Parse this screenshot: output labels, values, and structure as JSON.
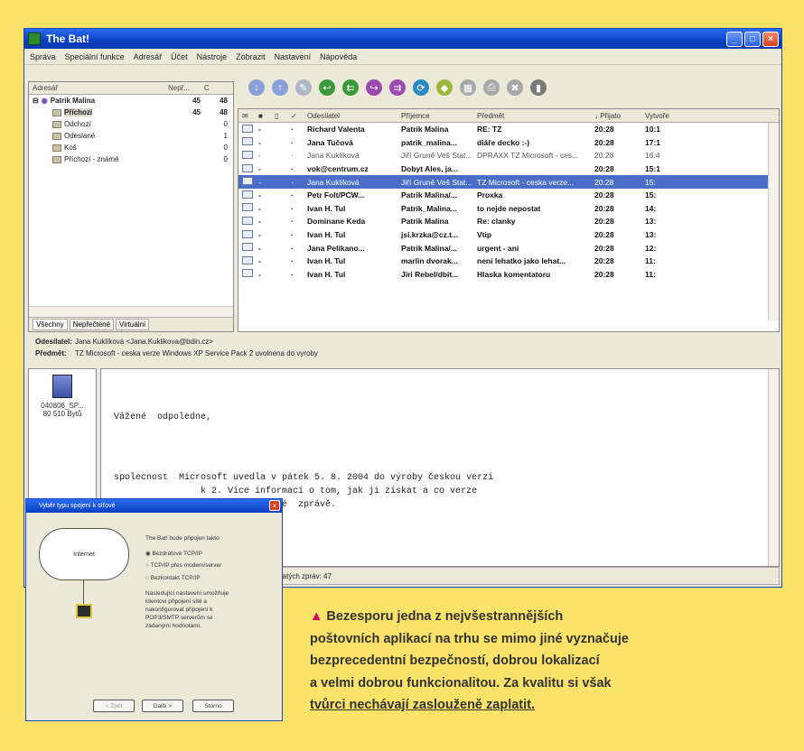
{
  "window": {
    "title": "The Bat!"
  },
  "menu": [
    "Správa",
    "Speciální funkce",
    "Adresář",
    "Účet",
    "Nástroje",
    "Zobrazit",
    "Nastavení",
    "Nápověda"
  ],
  "tree": {
    "headers": [
      "Adresář",
      "Nepř...",
      "C"
    ],
    "rows": [
      {
        "name": "Patrik Malina",
        "unread": "45",
        "total": "48",
        "bold": true
      },
      {
        "name": "Příchozí",
        "unread": "45",
        "total": "48",
        "bold": true
      },
      {
        "name": "Odchozí",
        "unread": "",
        "total": "0",
        "bold": false
      },
      {
        "name": "Odeslané",
        "unread": "",
        "total": "1",
        "bold": false
      },
      {
        "name": "Koš",
        "unread": "",
        "total": "0",
        "bold": false
      },
      {
        "name": "Příchozí - známé",
        "unread": "",
        "total": "0",
        "bold": false
      }
    ],
    "tabs": [
      "Všechny",
      "Nepřečtené",
      "Virtuální"
    ]
  },
  "message_list": {
    "headers": [
      "",
      "",
      "",
      "",
      "Odesílatel",
      "Příjemce",
      "Předmět",
      "↓ Přijato",
      "Vytvoře"
    ],
    "rows": [
      {
        "from": "Richard Valenta",
        "to": "Patrik Malina",
        "subject": "RE: TZ",
        "received": "20:28",
        "created": "10:1",
        "state": "unread"
      },
      {
        "from": "Jana Tučová",
        "to": "patrik_malina...",
        "subject": "diáře decko :-)",
        "received": "20:28",
        "created": "17:1",
        "state": "unread"
      },
      {
        "from": "Jana Kuklíková",
        "to": "Jiří Gruně Veš Stat...",
        "subject": "DPRAXX TZ Microsoft - ces...",
        "received": "20:28",
        "created": "16:4",
        "state": "read"
      },
      {
        "from": "vok@centrum.cz",
        "to": "Dobyt Ales, ja...",
        "subject": "",
        "received": "20:28",
        "created": "15:1",
        "state": "unread"
      },
      {
        "from": "Jana Kuklíková",
        "to": "Jiří Gruně Veš Stat...",
        "subject": "TZ Microsoft - ceska verze...",
        "received": "20:28",
        "created": "15:",
        "state": "selected"
      },
      {
        "from": "Petr Folt/PCW...",
        "to": "Patrik Malina/...",
        "subject": "Proxka",
        "received": "20:28",
        "created": "15:",
        "state": "unread"
      },
      {
        "from": "Ivan H. Tul",
        "to": "Patrik_Malina...",
        "subject": "to nejde nepostat",
        "received": "20:28",
        "created": "14:",
        "state": "unread"
      },
      {
        "from": "Dominane Keda",
        "to": "Patrik Malina",
        "subject": "Re: clanky",
        "received": "20:28",
        "created": "13:",
        "state": "unread"
      },
      {
        "from": "Ivan H. Tul",
        "to": "jsi.krzka@cz.t...",
        "subject": "Vtip",
        "received": "20:28",
        "created": "13:",
        "state": "unread"
      },
      {
        "from": "Jana Pelikano...",
        "to": "Patrik Malina/...",
        "subject": "urgent - ani",
        "received": "20:28",
        "created": "12:",
        "state": "unread"
      },
      {
        "from": "Ivan H. Tul",
        "to": "marlin dvorak...",
        "subject": "neni lehatko jako lehat...",
        "received": "20:28",
        "created": "11:",
        "state": "unread"
      },
      {
        "from": "Ivan H. Tul",
        "to": "Jiri Rebel/dbit...",
        "subject": "Hlaska komentatoru",
        "received": "20:28",
        "created": "11:",
        "state": "unread"
      }
    ]
  },
  "preview": {
    "from_label": "Odesílatel:",
    "from_value": "Jana Kuklíková <Jana.Kuklikova@bdin.cz>",
    "subject_label": "Předmět:",
    "subject_value": "TZ Microsoft - ceska verze Windows XP Service Pack 2 uvolnena do vyroby",
    "attachment_name": "040806_SP...",
    "attachment_size": "80 510 Bytů",
    "body_lines": [
      "Vážené  odpoledne,",
      "",
      "",
      "",
      "spolecnost  Microsoft uvedla v pátek 5. 8. 2004 do výroby českou verzi",
      "                k 2. Více informací o tom, jak ji získat a co verze",
      "                 iložené tiskové  zprávě."
    ],
    "status": "přijatých zpráv: 47"
  },
  "dialog": {
    "title": "Vyběr typu spojení k síťové",
    "cloud_label": "Internet",
    "question": "The Bat! bude připojen takto:",
    "options": [
      "Bezdrátové TCP/IP",
      "TCP/IP přes modem/server",
      "Bezkontakt TCP/IP"
    ],
    "note": "Následující nastavení umožňuje klientovi připojení sítě a nakonfigurovat připojení k POP3/SMTP serverům se zadanými hodnotami.",
    "buttons": [
      "< Zpět",
      "Další >",
      "Storno"
    ]
  },
  "caption": {
    "lines": [
      "Bezesporu jedna z nejvšestrannějších",
      "poštovních aplikací na trhu se mimo jiné vyznačuje",
      "bezprecedentní bezpečností, dobrou lokalizací",
      "a velmi dobrou funkcionalitou. Za kvalitu si však",
      "tvůrci nechávají zaslouženě zaplatit."
    ]
  },
  "colors": {
    "background": "#fbe36a",
    "accent_triangle": "#e0005a",
    "selection": "#4a6ec8"
  }
}
